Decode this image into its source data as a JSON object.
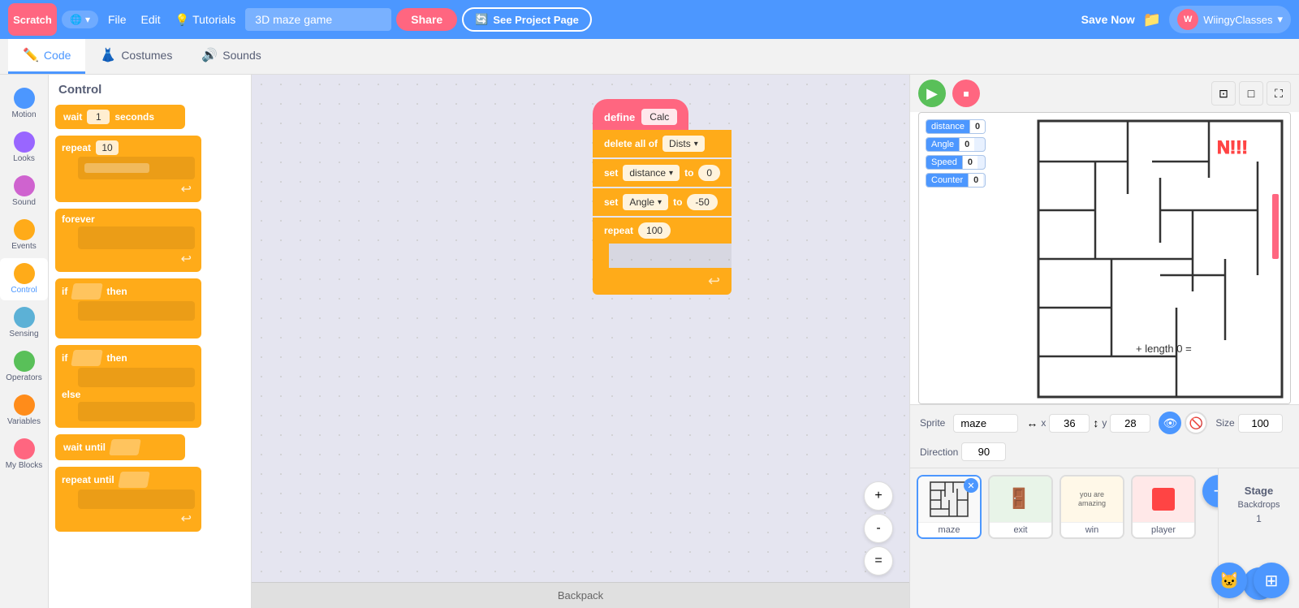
{
  "topnav": {
    "logo": "Scratch",
    "globe_label": "🌐",
    "globe_arrow": "▾",
    "file_label": "File",
    "edit_label": "Edit",
    "tutorials_icon": "💡",
    "tutorials_label": "Tutorials",
    "project_name": "3D maze game",
    "share_label": "Share",
    "see_project_icon": "🔄",
    "see_project_label": "See Project Page",
    "save_now_label": "Save Now",
    "folder_icon": "📁",
    "user_avatar_label": "W",
    "user_name": "WiingyClasses",
    "user_arrow": "▾"
  },
  "tabs": {
    "code_icon": "✏️",
    "code_label": "Code",
    "costumes_icon": "👗",
    "costumes_label": "Costumes",
    "sounds_icon": "🔊",
    "sounds_label": "Sounds"
  },
  "categories": [
    {
      "id": "motion",
      "label": "Motion",
      "color": "#4C97FF"
    },
    {
      "id": "looks",
      "label": "Looks",
      "color": "#9966FF"
    },
    {
      "id": "sound",
      "label": "Sound",
      "color": "#CF63CF"
    },
    {
      "id": "events",
      "label": "Events",
      "color": "#FFAB19"
    },
    {
      "id": "control",
      "label": "Control",
      "color": "#FFAB19",
      "active": true
    },
    {
      "id": "sensing",
      "label": "Sensing",
      "color": "#5CB1D6"
    },
    {
      "id": "operators",
      "label": "Operators",
      "color": "#59C059"
    },
    {
      "id": "variables",
      "label": "Variables",
      "color": "#FF8C1A"
    },
    {
      "id": "myblocks",
      "label": "My Blocks",
      "color": "#FF6680"
    }
  ],
  "blocks_panel": {
    "heading": "Control",
    "blocks": [
      {
        "type": "wait",
        "label": "wait",
        "value": "1",
        "unit": "seconds"
      },
      {
        "type": "repeat",
        "label": "repeat",
        "value": "10"
      },
      {
        "type": "forever",
        "label": "forever"
      },
      {
        "type": "if-then",
        "label": "if",
        "suffix": "then"
      },
      {
        "type": "if-else",
        "label": "if",
        "suffix": "then / else"
      },
      {
        "type": "wait-until",
        "label": "wait until"
      },
      {
        "type": "repeat-until",
        "label": "repeat until"
      }
    ]
  },
  "canvas_blocks": {
    "define_label": "define",
    "define_input": "Calc",
    "delete_label": "delete all of",
    "delete_dropdown": "Dists",
    "set1_label": "set",
    "set1_dropdown": "distance",
    "set1_to": "to",
    "set1_value": "0",
    "set2_label": "set",
    "set2_dropdown": "Angle",
    "set2_to": "to",
    "set2_value": "-50",
    "repeat_label": "repeat",
    "repeat_value": "100"
  },
  "zoom_controls": {
    "zoom_in_label": "+",
    "zoom_out_label": "-",
    "reset_label": "="
  },
  "backpack": {
    "label": "Backpack"
  },
  "var_monitors": [
    {
      "name": "distance",
      "value": "0"
    },
    {
      "name": "Angle",
      "value": "0"
    },
    {
      "name": "Speed",
      "value": "0"
    },
    {
      "name": "Counter",
      "value": "0"
    }
  ],
  "stage_dropdown": {
    "title": "Dists",
    "content": "(empty)"
  },
  "sprite_info": {
    "sprite_label": "Sprite",
    "sprite_name": "maze",
    "x_label": "x",
    "x_value": "36",
    "y_label": "y",
    "y_value": "28",
    "show_label": "Show",
    "size_label": "Size",
    "size_value": "100",
    "direction_label": "Direction",
    "direction_value": "90"
  },
  "sprites": [
    {
      "id": "maze",
      "label": "maze",
      "active": true,
      "icon": "🗺️"
    },
    {
      "id": "exit",
      "label": "exit",
      "active": false,
      "icon": "🚪"
    },
    {
      "id": "win",
      "label": "win",
      "active": false,
      "icon": "📝"
    },
    {
      "id": "player",
      "label": "player",
      "active": false,
      "icon": "🟥"
    }
  ],
  "stage_panel": {
    "stage_label": "Stage",
    "backdrops_label": "Backdrops",
    "backdrops_count": "1"
  }
}
